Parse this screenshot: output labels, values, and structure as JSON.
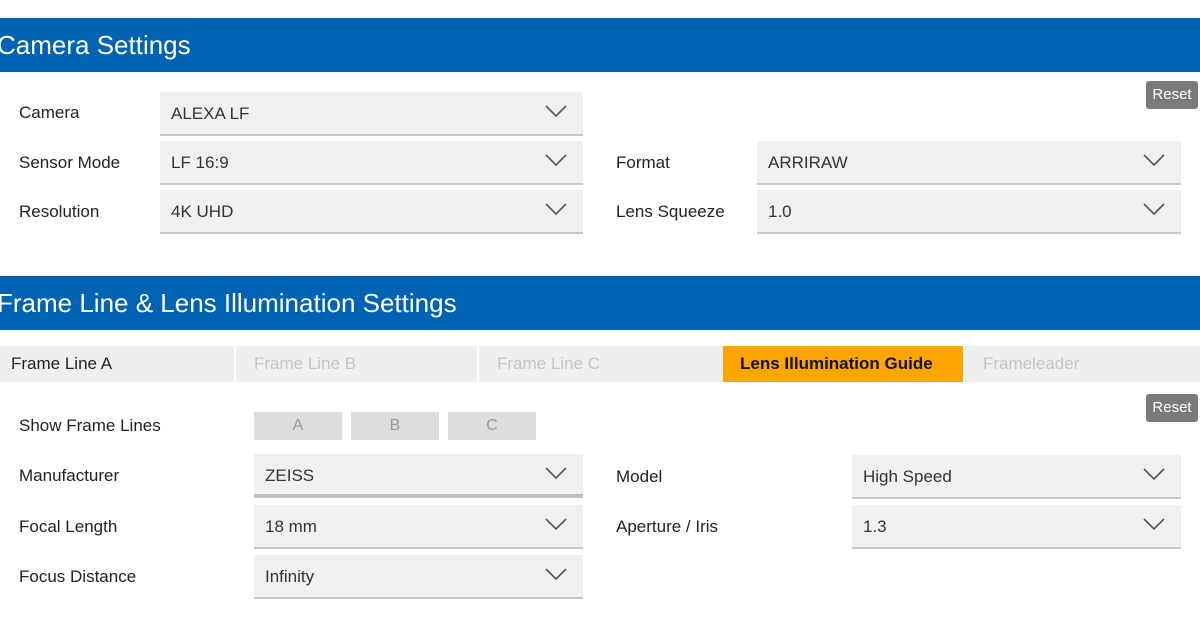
{
  "camera_section": {
    "title": "Camera Settings",
    "reset_label": "Reset",
    "fields": {
      "camera": {
        "label": "Camera",
        "value": "ALEXA LF"
      },
      "sensor_mode": {
        "label": "Sensor Mode",
        "value": "LF 16:9"
      },
      "resolution": {
        "label": "Resolution",
        "value": "4K UHD"
      },
      "format": {
        "label": "Format",
        "value": "ARRIRAW"
      },
      "lens_squeeze": {
        "label": "Lens Squeeze",
        "value": "1.0"
      }
    }
  },
  "frame_section": {
    "title": "Frame Line & Lens Illumination Settings",
    "reset_label": "Reset",
    "tabs": [
      "Frame Line A",
      "Frame Line B",
      "Frame Line C",
      "Lens Illumination Guide",
      "Frameleader"
    ],
    "show_frame_lines": {
      "label": "Show Frame Lines",
      "options": [
        "A",
        "B",
        "C"
      ]
    },
    "fields": {
      "manufacturer": {
        "label": "Manufacturer",
        "value": "ZEISS"
      },
      "model": {
        "label": "Model",
        "value": "High Speed"
      },
      "focal_length": {
        "label": "Focal Length",
        "value": "18 mm"
      },
      "aperture": {
        "label": "Aperture / Iris",
        "value": "1.3"
      },
      "focus_distance": {
        "label": "Focus Distance",
        "value": "Infinity"
      }
    }
  },
  "colors": {
    "header_blue": "#0062b2",
    "active_tab_orange": "#ffa500",
    "reset_gray": "#7a7a7a"
  },
  "icons": {
    "dropdown": "chevron-down-icon"
  }
}
